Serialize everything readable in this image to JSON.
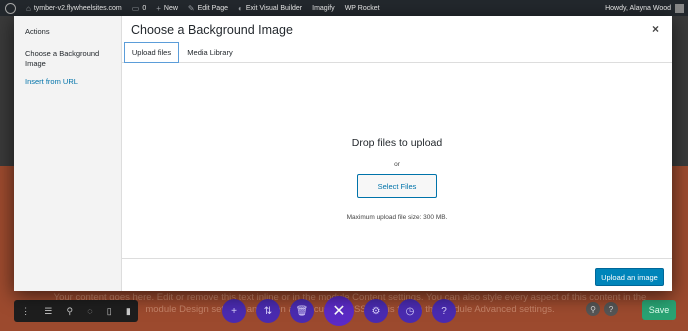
{
  "admin_bar": {
    "site": "tymber-v2.flywheelsites.com",
    "comments": "0",
    "new_label": "New",
    "edit_page": "Edit Page",
    "exit_builder": "Exit Visual Builder",
    "imagify": "Imagify",
    "wp_rocket": "WP Rocket",
    "howdy": "Howdy, Alayna Wood"
  },
  "modal": {
    "title": "Choose a Background Image",
    "sidebar": {
      "heading": "Actions",
      "items": [
        {
          "label": "Choose a Background Image"
        },
        {
          "label": "Insert from URL"
        }
      ]
    },
    "tabs": [
      {
        "label": "Upload files"
      },
      {
        "label": "Media Library"
      }
    ],
    "drop": {
      "title": "Drop files to upload",
      "or": "or",
      "select_button": "Select Files",
      "max_size": "Maximum upload file size: 300 MB."
    },
    "footer": {
      "upload_button": "Upload an image"
    },
    "close_glyph": "×"
  },
  "background_page": {
    "text": "Your content goes here. Edit or remove this text inline or in the module Content settings. You can also style every aspect of this content in the module Design settings and even apply custom CSS to this text in the module Advanced settings."
  },
  "builder": {
    "save_label": "Save"
  },
  "colors": {
    "primary_button": "#0085ba",
    "link": "#0073aa",
    "builder_purple": "#4a2bb0",
    "save_green": "#29a373",
    "page_orange": "#9c4a2e"
  }
}
